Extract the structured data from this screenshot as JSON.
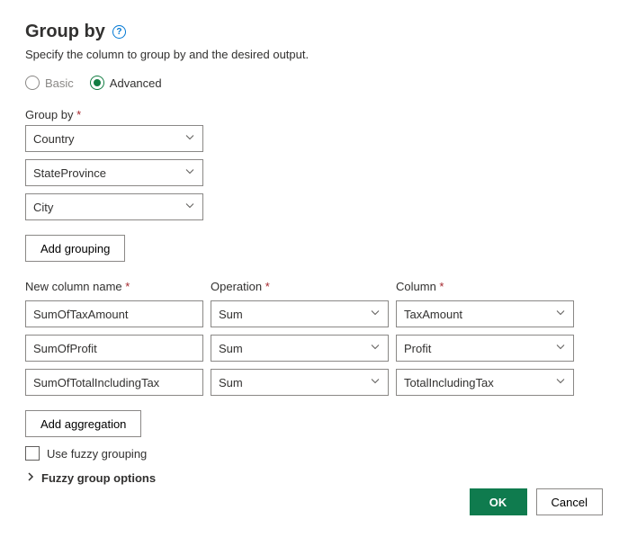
{
  "title": "Group by",
  "subtitle": "Specify the column to group by and the desired output.",
  "mode": {
    "basic": "Basic",
    "advanced": "Advanced"
  },
  "groupByLabel": "Group by",
  "groupByColumns": [
    {
      "value": "Country"
    },
    {
      "value": "StateProvince"
    },
    {
      "value": "City"
    }
  ],
  "addGroupingLabel": "Add grouping",
  "aggHeader": {
    "name": "New column name",
    "operation": "Operation",
    "column": "Column"
  },
  "aggregations": [
    {
      "name": "SumOfTaxAmount",
      "operation": "Sum",
      "column": "TaxAmount"
    },
    {
      "name": "SumOfProfit",
      "operation": "Sum",
      "column": "Profit"
    },
    {
      "name": "SumOfTotalIncludingTax",
      "operation": "Sum",
      "column": "TotalIncludingTax"
    }
  ],
  "addAggregationLabel": "Add aggregation",
  "fuzzyCheckbox": "Use fuzzy grouping",
  "fuzzyExpander": "Fuzzy group options",
  "footer": {
    "ok": "OK",
    "cancel": "Cancel"
  }
}
